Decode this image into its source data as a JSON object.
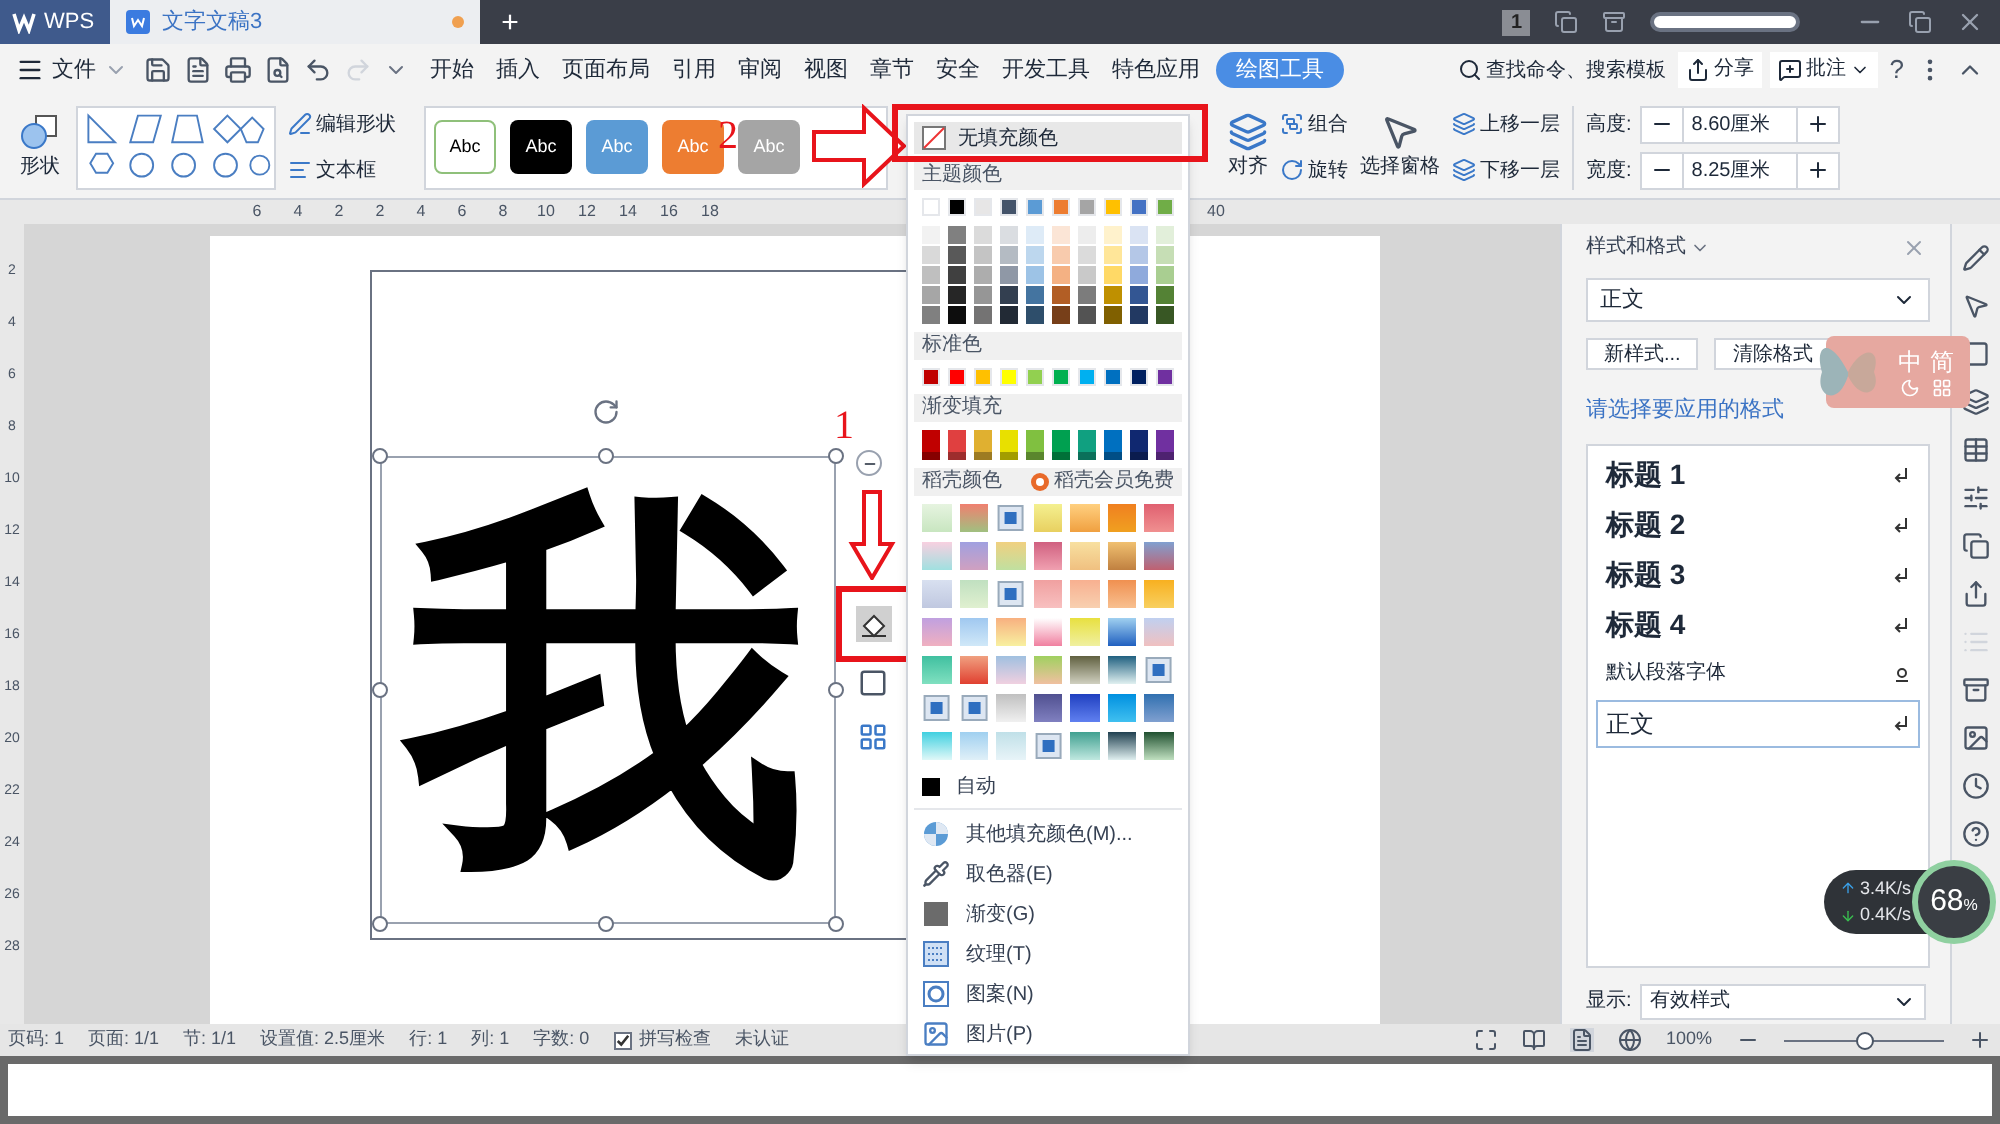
{
  "title_bar": {
    "app_tab": "WPS",
    "doc_tab": {
      "title": "文字文稿3",
      "unsaved": true
    },
    "new_tab": "+",
    "badge": "1"
  },
  "menu_bar": {
    "file": "文件",
    "tabs": [
      {
        "label": "开始",
        "selected": false
      },
      {
        "label": "插入",
        "selected": false
      },
      {
        "label": "页面布局",
        "selected": false
      },
      {
        "label": "引用",
        "selected": false
      },
      {
        "label": "审阅",
        "selected": false
      },
      {
        "label": "视图",
        "selected": false
      },
      {
        "label": "章节",
        "selected": false
      },
      {
        "label": "安全",
        "selected": false
      },
      {
        "label": "开发工具",
        "selected": false
      },
      {
        "label": "特色应用",
        "selected": false
      },
      {
        "label": "绘图工具",
        "selected": true
      }
    ],
    "search": "查找命令、搜索模板",
    "share": "分享",
    "comment": "批注",
    "help": "?"
  },
  "ribbon": {
    "shape": "形状",
    "edit_shape": "编辑形状",
    "text_box": "文本框",
    "style_presets": [
      {
        "label": "Abc",
        "color": "#ffffff"
      },
      {
        "label": "Abc",
        "color": "#000000"
      },
      {
        "label": "Abc",
        "color": "#5b9bd5"
      },
      {
        "label": "Abc",
        "color": "#ed7d31"
      },
      {
        "label": "Abc",
        "color": "#a5a5a5"
      }
    ],
    "align": "对齐",
    "group": "组合",
    "rotate": "旋转",
    "selection_pane": "选择窗格",
    "bring_forward": "上移一层",
    "send_backward": "下移一层",
    "height": {
      "label": "高度:",
      "value": "8.60厘米"
    },
    "width": {
      "label": "宽度:",
      "value": "8.25厘米"
    }
  },
  "ruler": {
    "top_labels": [
      "6",
      "4",
      "2",
      "2",
      "4",
      "6",
      "8",
      "10",
      "12",
      "14",
      "16",
      "18"
    ],
    "top_end_label": "40",
    "side_labels": [
      "2",
      "4",
      "6",
      "8",
      "10",
      "12",
      "14",
      "16",
      "18",
      "20",
      "22",
      "24",
      "26",
      "28"
    ]
  },
  "document": {
    "shape_text": "我"
  },
  "annotations": [
    {
      "label": "1"
    },
    {
      "label": "2"
    }
  ],
  "fill_menu": {
    "no_fill": "无填充颜色",
    "theme_colors": {
      "label": "主题颜色",
      "swatches": [
        {
          "color": "#ffffff"
        },
        {
          "color": "#000000"
        },
        {
          "color": "#e7e6e6"
        },
        {
          "color": "#44546a"
        },
        {
          "color": "#5b9bd5"
        },
        {
          "color": "#ed7d31"
        },
        {
          "color": "#a5a5a5"
        },
        {
          "color": "#ffc000"
        },
        {
          "color": "#4472c4"
        },
        {
          "color": "#70ad47"
        }
      ]
    },
    "standard_colors": {
      "label": "标准色",
      "swatches": [
        {
          "color": "#c00000"
        },
        {
          "color": "#ff0000"
        },
        {
          "color": "#ffc000"
        },
        {
          "color": "#ffff00"
        },
        {
          "color": "#92d050"
        },
        {
          "color": "#00b050"
        },
        {
          "color": "#00b0f0"
        },
        {
          "color": "#0070c0"
        },
        {
          "color": "#002060"
        },
        {
          "color": "#7030a0"
        }
      ]
    },
    "gradient_fill": {
      "label": "渐变填充",
      "swatches": [
        {
          "color": "#c00000"
        },
        {
          "color": "#e04040"
        },
        {
          "color": "#e0b030"
        },
        {
          "color": "#e8e000"
        },
        {
          "color": "#80c040"
        },
        {
          "color": "#00a050"
        },
        {
          "color": "#10a080"
        },
        {
          "color": "#0070c0"
        },
        {
          "color": "#102870"
        },
        {
          "color": "#7030a0"
        }
      ]
    },
    "docer_colors": {
      "label": "稻壳颜色",
      "promo": "稻壳会员免费"
    },
    "auto": "自动",
    "items": [
      {
        "label": "其他填充颜色(M)...",
        "kind": "palette"
      },
      {
        "label": "取色器(E)",
        "kind": "eyedropper"
      },
      {
        "label": "渐变(G)",
        "kind": "gradient"
      },
      {
        "label": "纹理(T)",
        "kind": "texture"
      },
      {
        "label": "图案(N)",
        "kind": "pattern"
      },
      {
        "label": "图片(P)",
        "kind": "picture"
      }
    ]
  },
  "styles_panel": {
    "title": "样式和格式",
    "current": "正文",
    "new_style": "新样式...",
    "clear": "清除格式",
    "prompt": "请选择要应用的格式",
    "styles": [
      {
        "label": "标题 1",
        "kind": "heading",
        "selected": false
      },
      {
        "label": "标题 2",
        "kind": "heading",
        "selected": false
      },
      {
        "label": "标题 3",
        "kind": "heading",
        "selected": false
      },
      {
        "label": "标题 4",
        "kind": "heading",
        "selected": false
      },
      {
        "label": "默认段落字体",
        "kind": "character",
        "selected": false
      },
      {
        "label": "正文",
        "kind": "paragraph",
        "selected": true
      }
    ],
    "show_label": "显示:",
    "show_value": "有效样式"
  },
  "ime_widget": {
    "lang": "中",
    "script": "简"
  },
  "network_widget": {
    "upload": "3.4K/s",
    "download": "0.4K/s",
    "percent": "68",
    "unit": "%"
  },
  "status_bar": {
    "items": [
      "页码: 1",
      "页面: 1/1",
      "节: 1/1",
      "设置值: 2.5厘米",
      "行: 1",
      "列: 1",
      "字数: 0"
    ],
    "spell_check": {
      "label": "拼写检查",
      "checked": true
    },
    "certify": "未认证",
    "zoom": "100%",
    "zoom_slider": {
      "level": 0.5
    }
  }
}
